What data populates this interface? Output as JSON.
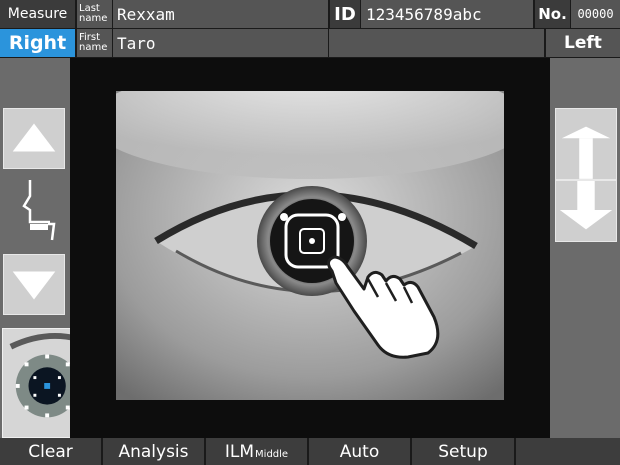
{
  "header": {
    "mode_label": "Measure",
    "last_name_label": [
      "Last",
      "name"
    ],
    "last_name_value": "Rexxam",
    "id_label": "ID",
    "id_value": "123456789abc",
    "no_label": "No.",
    "no_value": "00000",
    "eye_label": "Right",
    "first_name_label": [
      "First",
      "name"
    ],
    "first_name_value": "Taro",
    "side_label": "Left"
  },
  "left_panel": {
    "up_icon": "triangle-up-icon",
    "chinrest_icon": "chinrest-profile-icon",
    "down_icon": "triangle-down-icon",
    "eye_mode_icon": "eye-alignment-icon"
  },
  "right_panel": {
    "up_icon": "focus-up-arrow-icon",
    "down_icon": "focus-down-arrow-icon"
  },
  "viewer": {
    "image": "eye-camera-view",
    "overlay": "alignment-reticle",
    "gesture": "tap-hand-icon"
  },
  "bottom_bar": {
    "buttons": [
      {
        "label": "Clear"
      },
      {
        "label": "Analysis"
      },
      {
        "label": "ILM",
        "sub": "Middle"
      },
      {
        "label": "Auto"
      },
      {
        "label": "Setup"
      }
    ]
  },
  "colors": {
    "accent_blue": "#2b94dc",
    "panel_gray": "#6b6b6b",
    "button_gray": "#cfcfcf"
  }
}
